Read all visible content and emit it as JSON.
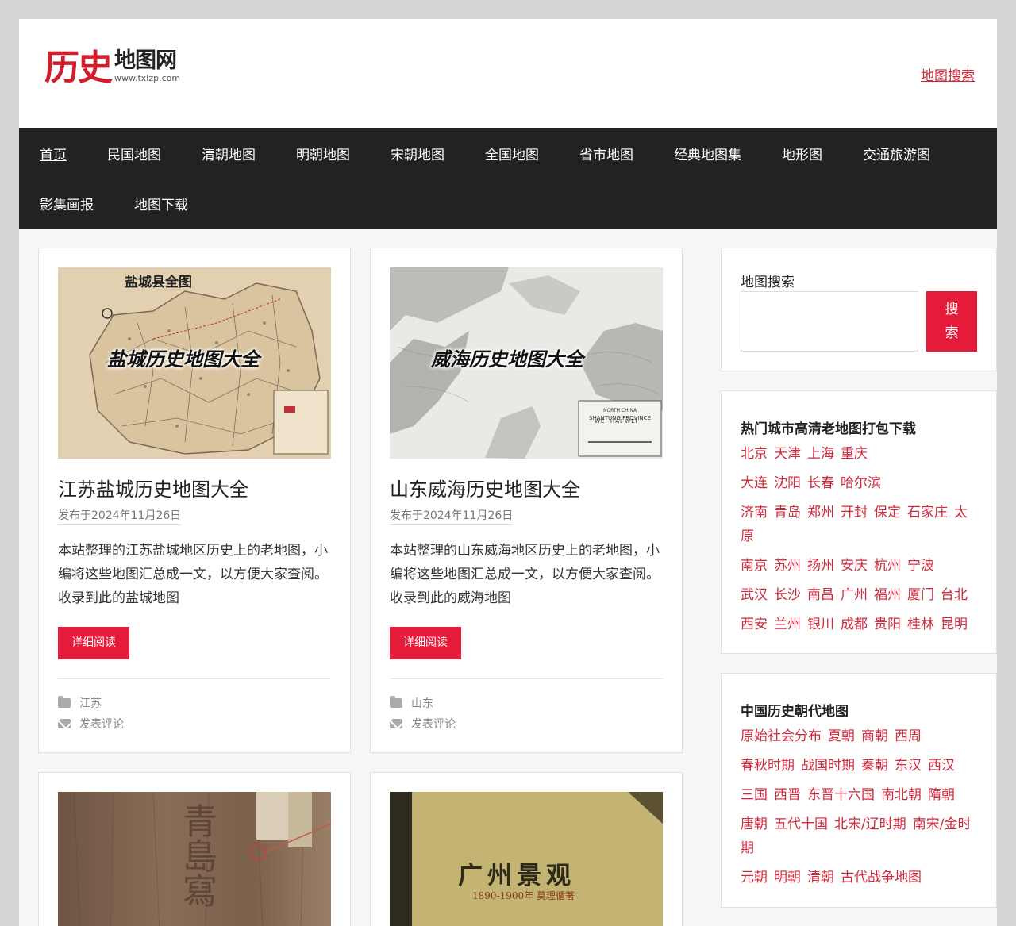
{
  "header": {
    "logo_main": "历史",
    "logo_sub": "地图网",
    "logo_url": "www.txlzp.com",
    "search_link": "地图搜索"
  },
  "nav": {
    "row1": [
      "首页",
      "民国地图",
      "清朝地图",
      "明朝地图",
      "宋朝地图",
      "全国地图",
      "省市地图",
      "经典地图集",
      "地形图",
      "交通旅游图"
    ],
    "row2": [
      "影集画报",
      "地图下载"
    ]
  },
  "posts": [
    {
      "thumb_title": "盐城县全图",
      "thumb_overlay": "盐城历史地图大全",
      "title": "江苏盐城历史地图大全",
      "meta": "发布于2024年11月26日",
      "excerpt": "本站整理的江苏盐城地区历史上的老地图，小编将这些地图汇总成一文，以方便大家查阅。收录到此的盐城地图",
      "readmore": "详细阅读",
      "category": "江苏",
      "comment": "发表评论"
    },
    {
      "thumb_title": "WEI-HAI-WEI",
      "thumb_overlay": "威海历史地图大全",
      "title": "山东威海历史地图大全",
      "meta": "发布于2024年11月26日",
      "excerpt": "本站整理的山东威海地区历史上的老地图，小编将这些地图汇总成一文，以方便大家查阅。收录到此的威海地图",
      "readmore": "详细阅读",
      "category": "山东",
      "comment": "发表评论"
    },
    {
      "thumb_text": "青島寫"
    },
    {
      "thumb_title": "广州景观",
      "thumb_sub": "1890-1900年 莫理循著"
    }
  ],
  "sidebar": {
    "search_label": "地图搜索",
    "search_button": "搜索",
    "widget1_title": "热门城市高清老地图打包下载",
    "widget1_lines": [
      [
        "北京",
        "天津",
        "上海",
        "重庆"
      ],
      [
        "大连",
        "沈阳",
        "长春",
        "哈尔滨"
      ],
      [
        "济南",
        "青岛",
        "郑州",
        "开封",
        "保定",
        "石家庄",
        "太原"
      ],
      [
        "南京",
        "苏州",
        "扬州",
        "安庆",
        "杭州",
        "宁波"
      ],
      [
        "武汉",
        "长沙",
        "南昌",
        "广州",
        "福州",
        "厦门",
        "台北"
      ],
      [
        "西安",
        "兰州",
        "银川",
        "成都",
        "贵阳",
        "桂林",
        "昆明"
      ]
    ],
    "widget2_title": "中国历史朝代地图",
    "widget2_lines": [
      [
        "原始社会分布",
        "夏朝",
        "商朝",
        "西周"
      ],
      [
        "春秋时期",
        "战国时期",
        "秦朝",
        "东汉",
        "西汉"
      ],
      [
        "三国",
        "西晋",
        "东晋十六国",
        "南北朝",
        "隋朝"
      ],
      [
        "唐朝",
        "五代十国",
        "北宋/辽时期",
        "南宋/金时期"
      ],
      [
        "元朝",
        "明朝",
        "清朝",
        "古代战争地图"
      ]
    ]
  },
  "colors": {
    "accent": "#e41b3a",
    "link": "#d12a3d",
    "nav_bg": "#222222"
  }
}
